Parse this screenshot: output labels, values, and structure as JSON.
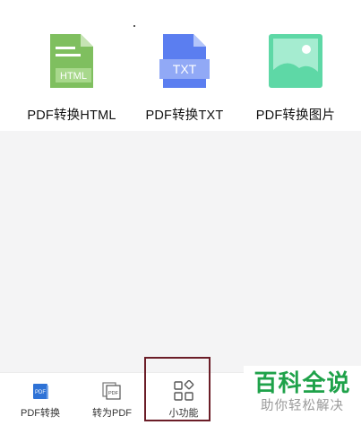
{
  "tools": [
    {
      "label": "PDF转换HTML",
      "icon": "html-file-icon",
      "icon_text": "HTML",
      "color": "#7fbf5f"
    },
    {
      "label": "PDF转换TXT",
      "icon": "txt-file-icon",
      "icon_text": "TXT",
      "color": "#5b7ef0"
    },
    {
      "label": "PDF转换图片",
      "icon": "image-file-icon",
      "color": "#5ed8a6"
    }
  ],
  "bottom_nav": [
    {
      "label": "PDF转换",
      "icon": "pdf-doc-icon",
      "icon_text": "PDF"
    },
    {
      "label": "转为PDF",
      "icon": "to-pdf-icon",
      "icon_text": "PDF"
    },
    {
      "label": "小功能",
      "icon": "grid-apps-icon",
      "selected": true
    }
  ],
  "watermark": {
    "title": "百科全说",
    "subtitle": "助你轻松解决"
  }
}
